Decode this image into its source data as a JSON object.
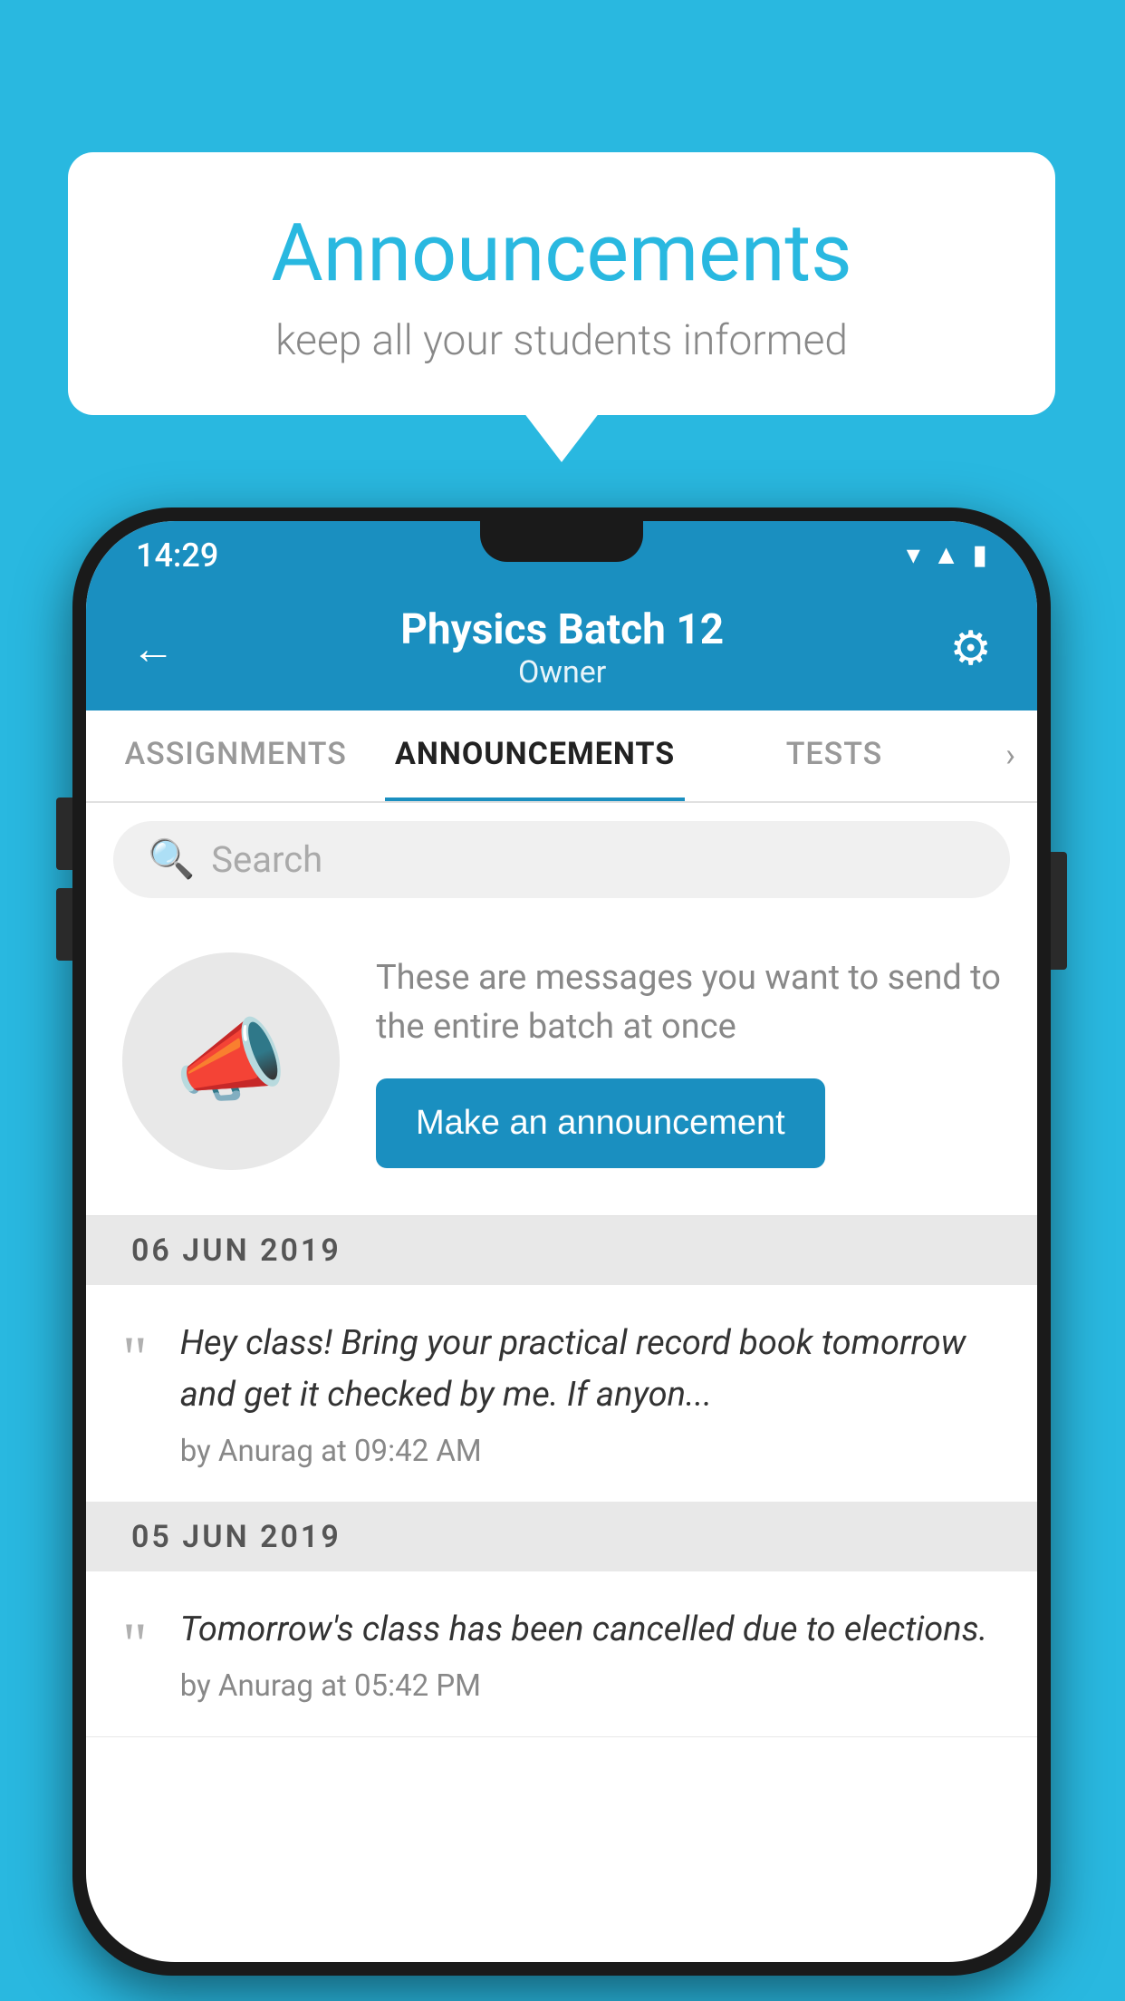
{
  "background_color": "#29B8E0",
  "speech_bubble": {
    "title": "Announcements",
    "subtitle": "keep all your students informed"
  },
  "phone": {
    "status_bar": {
      "time": "14:29"
    },
    "header": {
      "back_label": "←",
      "batch_name": "Physics Batch 12",
      "role": "Owner",
      "gear_label": "⚙"
    },
    "tabs": [
      {
        "label": "ASSIGNMENTS",
        "active": false
      },
      {
        "label": "ANNOUNCEMENTS",
        "active": true
      },
      {
        "label": "TESTS",
        "active": false
      }
    ],
    "tabs_more": "›",
    "search": {
      "placeholder": "Search"
    },
    "announcement_cta": {
      "description": "These are messages you want to send to the entire batch at once",
      "button_label": "Make an announcement"
    },
    "date_sections": [
      {
        "date": "06  JUN  2019",
        "items": [
          {
            "text": "Hey class! Bring your practical record book tomorrow and get it checked by me. If anyon...",
            "meta": "by Anurag at 09:42 AM"
          }
        ]
      },
      {
        "date": "05  JUN  2019",
        "items": [
          {
            "text": "Tomorrow's class has been cancelled due to elections.",
            "meta": "by Anurag at 05:42 PM"
          }
        ]
      }
    ]
  }
}
